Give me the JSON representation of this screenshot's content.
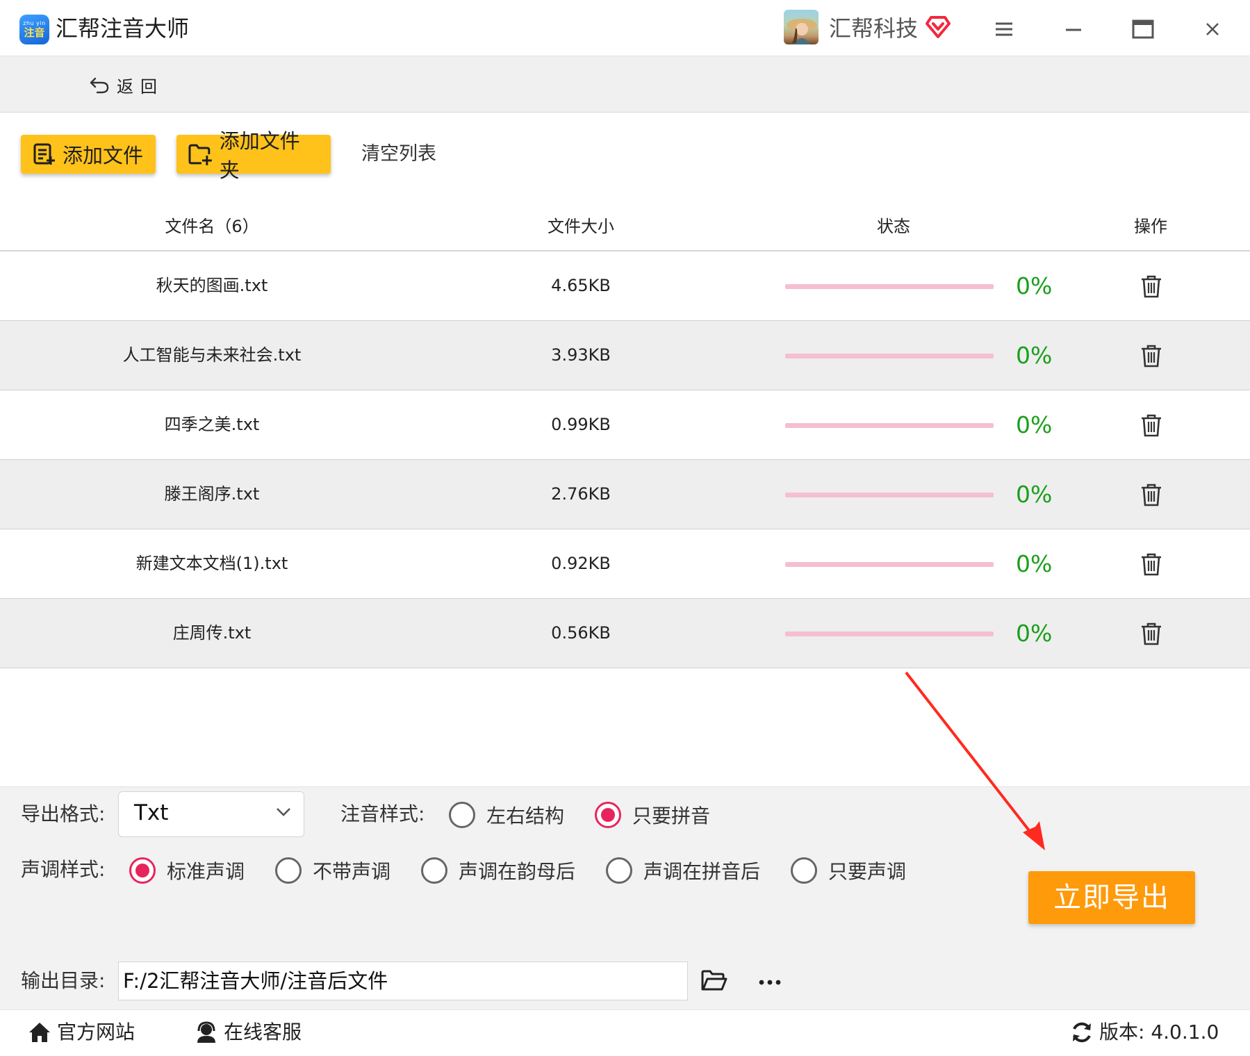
{
  "app": {
    "logo_top": "zhu yin",
    "logo_bottom": "注音",
    "title": "汇帮注音大师",
    "company": "汇帮科技"
  },
  "nav": {
    "back_label": "返回"
  },
  "toolbar": {
    "add_file": "添加文件",
    "add_folder": "添加文件夹",
    "clear_list": "清空列表"
  },
  "table": {
    "headers": {
      "name": "文件名（6）",
      "size": "文件大小",
      "status": "状态",
      "action": "操作"
    },
    "rows": [
      {
        "name": "秋天的图画.txt",
        "size": "4.65KB",
        "progress": "0%"
      },
      {
        "name": "人工智能与未来社会.txt",
        "size": "3.93KB",
        "progress": "0%"
      },
      {
        "name": "四季之美.txt",
        "size": "0.99KB",
        "progress": "0%"
      },
      {
        "name": "滕王阁序.txt",
        "size": "2.76KB",
        "progress": "0%"
      },
      {
        "name": "新建文本文档(1).txt",
        "size": "0.92KB",
        "progress": "0%"
      },
      {
        "name": "庄周传.txt",
        "size": "0.56KB",
        "progress": "0%"
      }
    ]
  },
  "options": {
    "export_format_label": "导出格式:",
    "export_format_value": "Txt",
    "annotation_style_label": "注音样式:",
    "annotation_options": [
      "左右结构",
      "只要拼音"
    ],
    "annotation_selected": 1,
    "tone_style_label": "声调样式:",
    "tone_options": [
      "标准声调",
      "不带声调",
      "声调在韵母后",
      "声调在拼音后",
      "只要声调"
    ],
    "tone_selected": 0,
    "output_dir_label": "输出目录:",
    "output_dir_value": "F:/2汇帮注音大师/注音后文件",
    "export_button": "立即导出"
  },
  "footer": {
    "website": "官方网站",
    "support": "在线客服",
    "version": "版本:  4.0.1.0"
  },
  "colors": {
    "accent_yellow": "#ffc21a",
    "export_orange": "#ff9a0b",
    "radio_on": "#e8245d",
    "progress_text": "#1a9f1a",
    "progress_track": "#f5bfd0",
    "arrow": "#ff2a1f"
  },
  "icons": {
    "back": "undo-arrow-icon",
    "menu": "hamburger-icon",
    "minimize": "minimize-icon",
    "maximize": "maximize-icon",
    "close": "close-icon",
    "delete": "trash-icon",
    "folder": "folder-open-icon",
    "more": "ellipsis-icon",
    "home": "home-icon",
    "support": "headset-icon",
    "refresh": "refresh-icon",
    "vip": "vip-diamond-icon"
  }
}
